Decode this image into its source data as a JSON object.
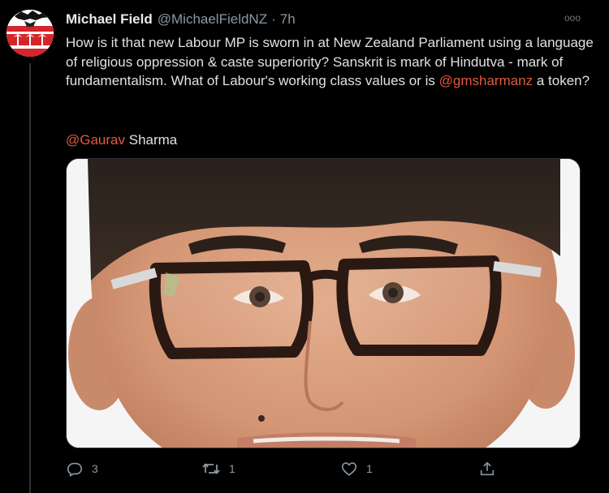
{
  "tweet": {
    "author_name": "Michael Field",
    "author_handle": "@MichaelFieldNZ",
    "separator": "·",
    "time": "7h",
    "more_label": "ooo",
    "text_parts": {
      "before_mention": "How is it that new Labour MP is sworn in at New Zealand Parliament using a language of religious oppression & caste superiority? Sanskrit is mark of Hindutva - mark of fundamentalism. What of Labour's working class values or is ",
      "mention": "@gmsharmanz",
      "after_mention": " a token?"
    },
    "second_line": {
      "mention": "@Gaurav",
      "rest": " Sharma"
    },
    "media": {
      "type": "photo",
      "subject": "portrait-photo"
    },
    "actions": {
      "reply_count": "3",
      "retweet_count": "1",
      "like_count": "1"
    }
  },
  "colors": {
    "background": "#000000",
    "mention": "#e0593f",
    "muted": "#8b98a5",
    "text": "#dfe1e2"
  },
  "icons": [
    "avatar-logo",
    "more-icon",
    "reply-icon",
    "retweet-icon",
    "like-icon",
    "share-icon"
  ]
}
